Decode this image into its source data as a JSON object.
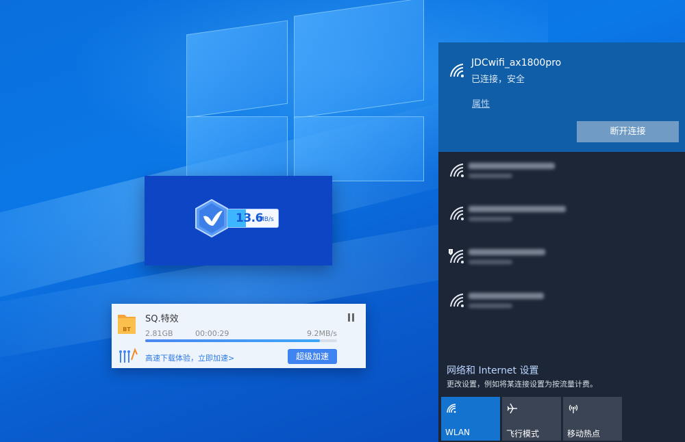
{
  "desktop": {
    "speed_widget": {
      "speed_value": "13.6",
      "speed_unit": "MB/s"
    },
    "download": {
      "file_badge": "BT",
      "title": "SQ.特效",
      "size": "2.81GB",
      "elapsed": "00:00:29",
      "rate": "9.2MB/s",
      "progress": 0.91,
      "promo_text": "高速下载体验，立即加速>",
      "boost_button": "超级加速"
    }
  },
  "network_flyout": {
    "connected": {
      "ssid": "JDCwifi_ax1800pro",
      "status": "已连接，安全",
      "properties_link": "属性",
      "disconnect_button": "断开连接"
    },
    "other_networks": [
      {
        "secured": false
      },
      {
        "secured": false
      },
      {
        "secured": true
      },
      {
        "secured": false
      }
    ],
    "settings_link": "网络和 Internet 设置",
    "settings_desc": "更改设置，例如将某连接设置为按流量计费。",
    "quick_actions": [
      {
        "label": "WLAN",
        "icon": "wifi-icon",
        "active": true
      },
      {
        "label": "飞行模式",
        "icon": "airplane-icon",
        "active": false
      },
      {
        "label": "移动热点",
        "icon": "hotspot-icon",
        "active": false
      }
    ],
    "colors": {
      "connected_bg": "#105ea8",
      "panel_bg": "#1d2636",
      "accent": "#1473cf"
    }
  }
}
